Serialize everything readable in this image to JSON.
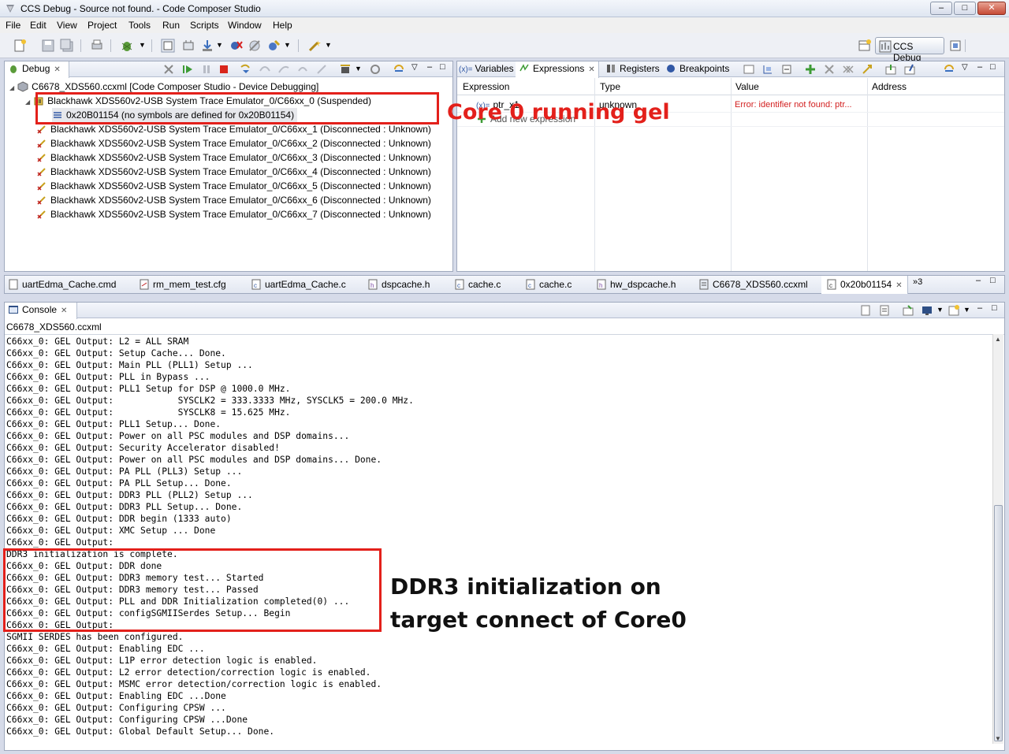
{
  "window": {
    "title": "CCS Debug - Source not found. - Code Composer Studio",
    "controls": {
      "minimize": "–",
      "maximize": "□",
      "close": "✕"
    }
  },
  "menu": [
    "File",
    "Edit",
    "View",
    "Project",
    "Tools",
    "Run",
    "Scripts",
    "Window",
    "Help"
  ],
  "perspective": {
    "label": "CCS Debug"
  },
  "debug_view": {
    "tab_label": "Debug",
    "root": "C6678_XDS560.ccxml [Code Composer Studio - Device Debugging]",
    "cores": [
      {
        "label": "Blackhawk XDS560v2-USB System Trace Emulator_0/C66xx_0 (Suspended)",
        "state": "suspended"
      },
      {
        "label": "Blackhawk XDS560v2-USB System Trace Emulator_0/C66xx_1 (Disconnected : Unknown)",
        "state": "disconnected"
      },
      {
        "label": "Blackhawk XDS560v2-USB System Trace Emulator_0/C66xx_2 (Disconnected : Unknown)",
        "state": "disconnected"
      },
      {
        "label": "Blackhawk XDS560v2-USB System Trace Emulator_0/C66xx_3 (Disconnected : Unknown)",
        "state": "disconnected"
      },
      {
        "label": "Blackhawk XDS560v2-USB System Trace Emulator_0/C66xx_4 (Disconnected : Unknown)",
        "state": "disconnected"
      },
      {
        "label": "Blackhawk XDS560v2-USB System Trace Emulator_0/C66xx_5 (Disconnected : Unknown)",
        "state": "disconnected"
      },
      {
        "label": "Blackhawk XDS560v2-USB System Trace Emulator_0/C66xx_6 (Disconnected : Unknown)",
        "state": "disconnected"
      },
      {
        "label": "Blackhawk XDS560v2-USB System Trace Emulator_0/C66xx_7 (Disconnected : Unknown)",
        "state": "disconnected"
      }
    ],
    "frame": "0x20B01154  (no symbols are defined for 0x20B01154)"
  },
  "expressions_view": {
    "tabs": [
      "Variables",
      "Expressions",
      "Registers",
      "Breakpoints"
    ],
    "active_tab": "Expressions",
    "columns": [
      "Expression",
      "Type",
      "Value",
      "Address"
    ],
    "rows": [
      {
        "expression": "ptr_x1",
        "type": "unknown",
        "value": "Error: identifier not found: ptr...",
        "address": ""
      }
    ],
    "add_new": "Add new expression"
  },
  "editor_tabs": [
    "uartEdma_Cache.cmd",
    "rm_mem_test.cfg",
    "uartEdma_Cache.c",
    "dspcache.h",
    "cache.c",
    "cache.c",
    "hw_dspcache.h",
    "C6678_XDS560.ccxml",
    "0x20b01154"
  ],
  "editor_overflow": "»3",
  "console": {
    "tab_label": "Console",
    "source": "C6678_XDS560.ccxml",
    "lines": [
      "C66xx_0: GEL Output: L2 = ALL SRAM",
      "C66xx_0: GEL Output: Setup Cache... Done.",
      "C66xx_0: GEL Output: Main PLL (PLL1) Setup ...",
      "C66xx_0: GEL Output: PLL in Bypass ...",
      "C66xx_0: GEL Output: PLL1 Setup for DSP @ 1000.0 MHz.",
      "C66xx_0: GEL Output:            SYSCLK2 = 333.3333 MHz, SYSCLK5 = 200.0 MHz.",
      "C66xx_0: GEL Output:            SYSCLK8 = 15.625 MHz.",
      "C66xx_0: GEL Output: PLL1 Setup... Done.",
      "C66xx_0: GEL Output: Power on all PSC modules and DSP domains...",
      "C66xx_0: GEL Output: Security Accelerator disabled!",
      "C66xx_0: GEL Output: Power on all PSC modules and DSP domains... Done.",
      "C66xx_0: GEL Output: PA PLL (PLL3) Setup ...",
      "C66xx_0: GEL Output: PA PLL Setup... Done.",
      "C66xx_0: GEL Output: DDR3 PLL (PLL2) Setup ...",
      "C66xx_0: GEL Output: DDR3 PLL Setup... Done.",
      "C66xx_0: GEL Output: DDR begin (1333 auto)",
      "C66xx_0: GEL Output: XMC Setup ... Done",
      "C66xx_0: GEL Output: ",
      "DDR3 initialization is complete.",
      "C66xx_0: GEL Output: DDR done",
      "C66xx_0: GEL Output: DDR3 memory test... Started",
      "C66xx_0: GEL Output: DDR3 memory test... Passed",
      "C66xx_0: GEL Output: PLL and DDR Initialization completed(0) ...",
      "C66xx_0: GEL Output: configSGMIISerdes Setup... Begin",
      "C66xx_0: GEL Output: ",
      "SGMII SERDES has been configured.",
      "C66xx_0: GEL Output: Enabling EDC ...",
      "C66xx_0: GEL Output: L1P error detection logic is enabled.",
      "C66xx_0: GEL Output: L2 error detection/correction logic is enabled.",
      "C66xx_0: GEL Output: MSMC error detection/correction logic is enabled.",
      "C66xx_0: GEL Output: Enabling EDC ...Done",
      "C66xx_0: GEL Output: Configuring CPSW ...",
      "C66xx_0: GEL Output: Configuring CPSW ...Done",
      "C66xx_0: GEL Output: Global Default Setup... Done."
    ]
  },
  "annotations": {
    "core0": "Core 0 running gel",
    "ddr3_line1": "DDR3 initialization on",
    "ddr3_line2": "target connect of Core0"
  },
  "colors": {
    "annotation": "#e3201b",
    "error_text": "#d21f1f"
  }
}
